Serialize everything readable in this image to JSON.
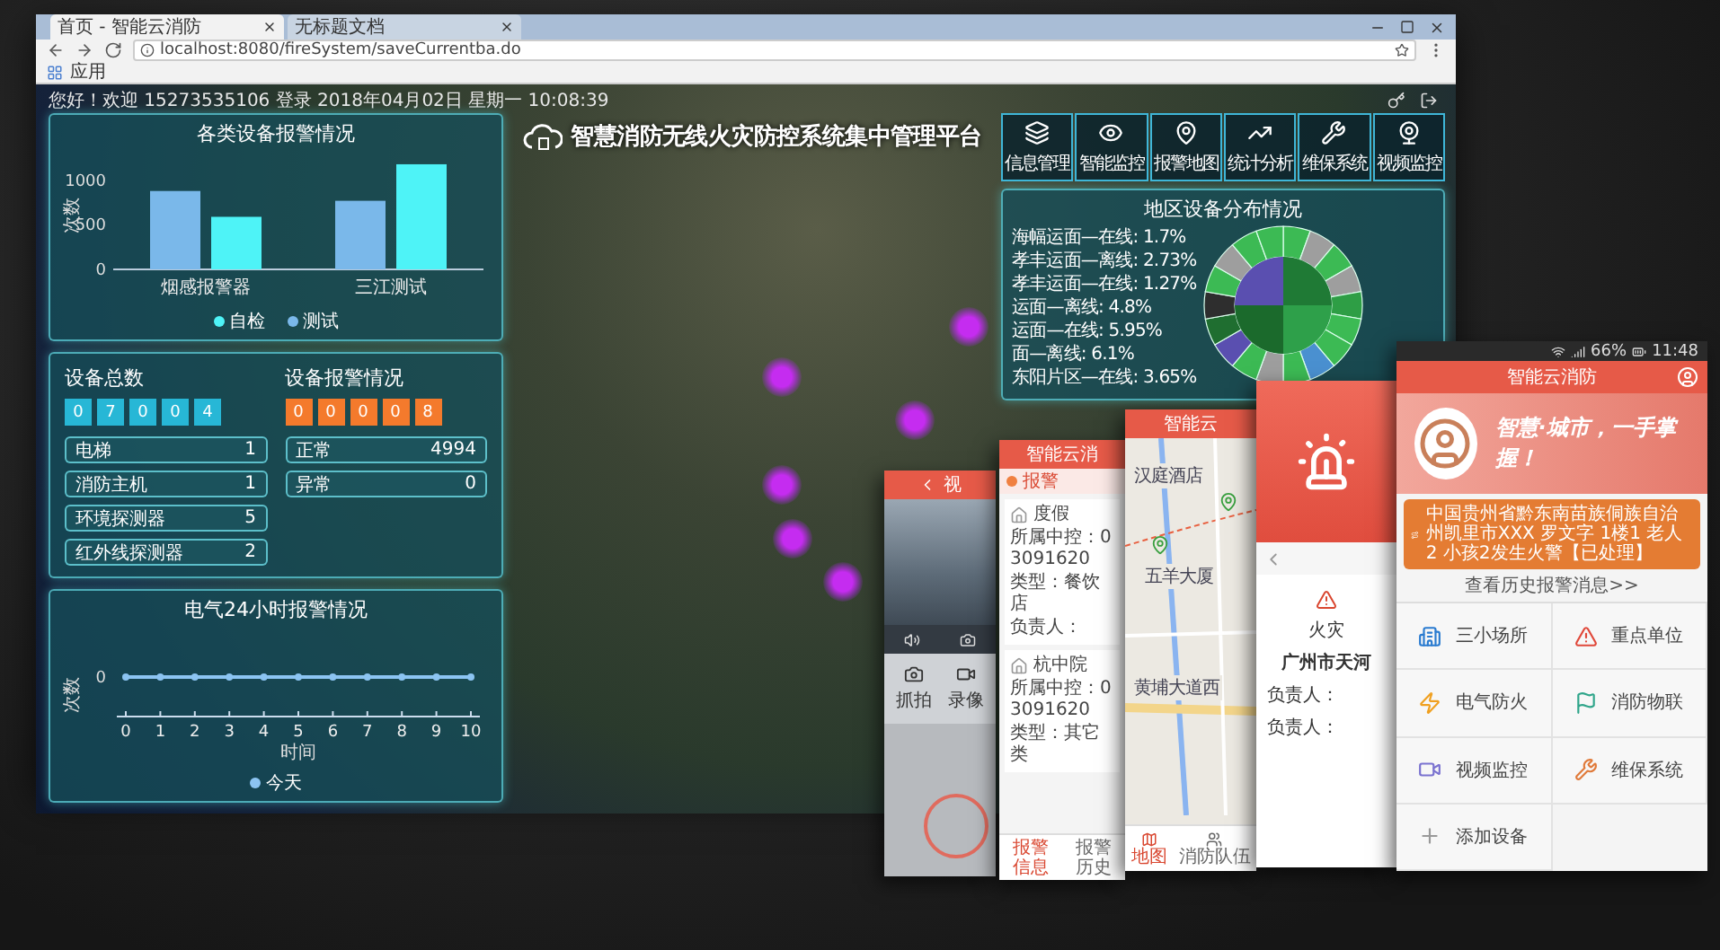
{
  "browser": {
    "tabs": [
      {
        "label": "首页 - 智能云消防",
        "selected": true
      },
      {
        "label": "无标题文档",
        "selected": false
      }
    ],
    "url": "localhost:8080/fireSystem/saveCurrentba.do",
    "bookmarks": [
      "应用"
    ]
  },
  "dashboard": {
    "greeting": "您好！欢迎 15273535106 登录 2018年04月02日 星期一 10:08:39",
    "title": "智慧消防无线火灾防控系统集中管理平台",
    "nav": [
      {
        "label": "信息管理",
        "kind": "layers"
      },
      {
        "label": "智能监控",
        "kind": "eye"
      },
      {
        "label": "报警地图",
        "kind": "pin"
      },
      {
        "label": "统计分析",
        "kind": "chart"
      },
      {
        "label": "维保系统",
        "kind": "wrench"
      },
      {
        "label": "视频监控",
        "kind": "camera"
      }
    ],
    "alarm_chart": {
      "title": "各类设备报警情况",
      "chart_data": {
        "type": "bar",
        "legend": "bottom",
        "ylabel": "次数",
        "categories": [
          "烟感报警器",
          "三江测试"
        ],
        "ylim": [
          0,
          1250
        ],
        "yticks": [
          0,
          500,
          1000
        ],
        "series": [
          {
            "name": "测试",
            "color": "#7ab8ea",
            "values": [
              880,
              770
            ]
          },
          {
            "name": "自检",
            "color": "#4ef3f7",
            "values": [
              590,
              1180
            ]
          }
        ]
      }
    },
    "stats": [
      {
        "title": "设备总数",
        "color": "#27b7d6",
        "digits": [
          "0",
          "7",
          "0",
          "0",
          "4"
        ],
        "items": [
          {
            "label": "电梯",
            "value": "1"
          },
          {
            "label": "消防主机",
            "value": "1"
          },
          {
            "label": "环境探测器",
            "value": "5"
          },
          {
            "label": "红外线探测器",
            "value": "2"
          }
        ]
      },
      {
        "title": "设备报警情况",
        "color": "#f47a2c",
        "digits": [
          "0",
          "0",
          "0",
          "0",
          "8"
        ],
        "items": [
          {
            "label": "正常",
            "value": "4994"
          },
          {
            "label": "异常",
            "value": "0"
          }
        ]
      }
    ],
    "hourly_chart": {
      "title": "电气24小时报警情况",
      "y_axis_title": "次数",
      "y_tick": "0",
      "x_ticks": [
        "0",
        "1",
        "2",
        "3",
        "4",
        "5",
        "6",
        "7",
        "8",
        "9",
        "10"
      ],
      "x_axis_title": "时间",
      "legend": "今天"
    },
    "region": {
      "title": "地区设备分布情况",
      "labels": [
        "海幅运面—在线: 1.7%",
        "孝丰运面—离线: 2.73%",
        "孝丰运面—在线: 1.27%",
        "运面—离线: 4.8%",
        "运面—在线: 5.95%",
        "面—离线: 6.1%",
        "东阳片区—在线: 3.65%"
      ]
    }
  },
  "phones": [
    {
      "kind": "video",
      "title": "视",
      "controls": [
        "抓拍",
        "录像"
      ]
    },
    {
      "kind": "list",
      "title": "智能云消",
      "tab": {
        "label": "报警",
        "selected": true
      },
      "cards": [
        {
          "name": "度假",
          "lines": [
            "所属中控：03091620",
            "类型：餐饮店",
            "负责人："
          ]
        },
        {
          "name": "杭中院",
          "lines": [
            "所属中控：03091620",
            "类型：其它类"
          ]
        }
      ],
      "nav": [
        "报警信息",
        "报警历史"
      ]
    },
    {
      "kind": "map",
      "title": "智能云",
      "places": [
        "汉庭酒店",
        "五羊大厦",
        "黄埔大道西"
      ],
      "nav": [
        {
          "label": "地图",
          "selected": true
        },
        {
          "label": "消防队伍",
          "selected": false
        }
      ]
    },
    {
      "kind": "alarm",
      "event": "火灾",
      "address": "广州市天河",
      "lines": [
        "负责人：",
        "负责人："
      ]
    },
    {
      "kind": "home",
      "battery": "66%",
      "time": "11:48",
      "title": "智能云消防",
      "slogan": "智慧·城市，一手掌握！",
      "alert": "中国贵州省黔东南苗族侗族自治州凯里市XXX 罗文字 1楼1 老人2 小孩2发生火警【已处理】",
      "history_link": "查看历史报警消息>>",
      "tiles": [
        {
          "label": "三小场所",
          "kind": "building"
        },
        {
          "label": "重点单位",
          "kind": "warning"
        },
        {
          "label": "电气防火",
          "kind": "bolt"
        },
        {
          "label": "消防物联",
          "kind": "flag"
        },
        {
          "label": "视频监控",
          "kind": "video"
        },
        {
          "label": "维保系统",
          "kind": "tools"
        },
        {
          "label": "添加设备",
          "kind": "add"
        }
      ]
    }
  ]
}
